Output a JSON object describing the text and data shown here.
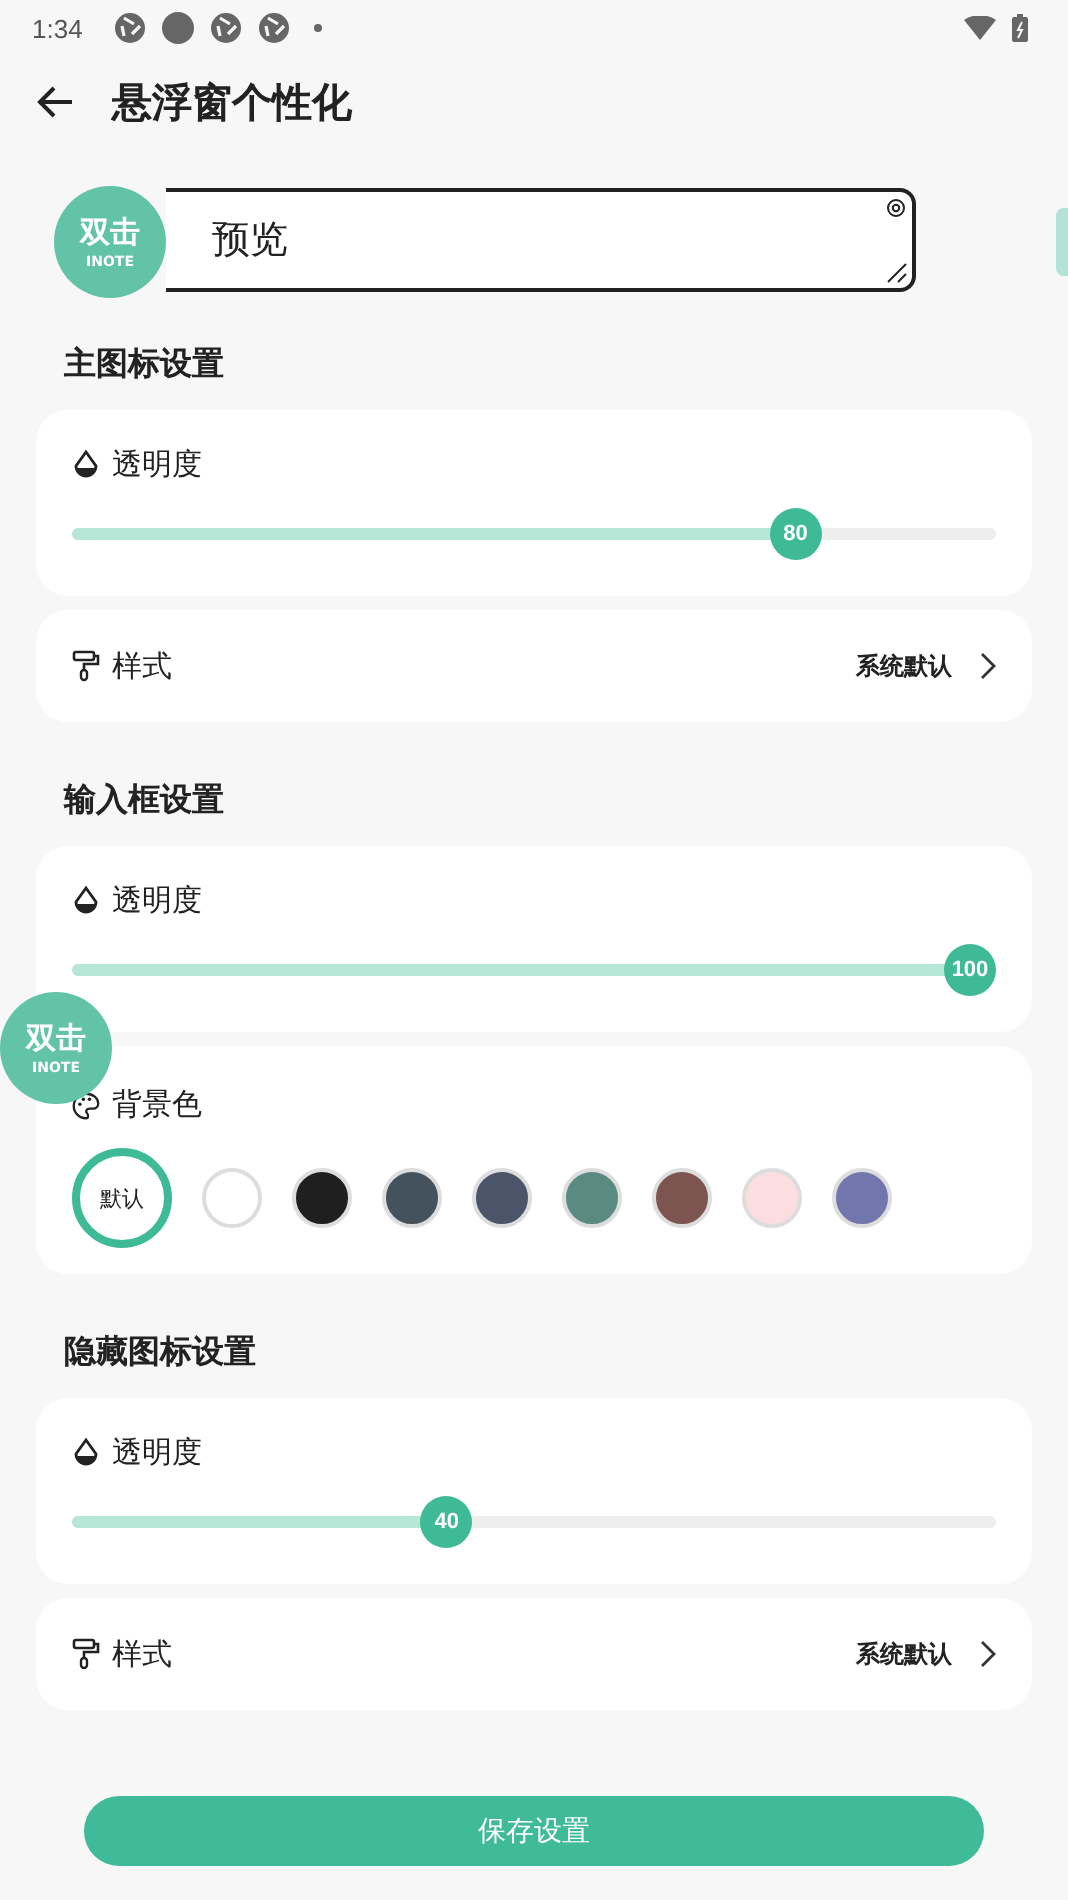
{
  "status_bar": {
    "time": "1:34"
  },
  "header": {
    "title": "悬浮窗个性化"
  },
  "preview": {
    "bubble_text": "双击",
    "bubble_subtext": "INOTE",
    "text": "预览"
  },
  "sections": [
    {
      "title": "主图标设置",
      "cards": [
        {
          "kind": "slider",
          "label": "透明度",
          "level": 0.8,
          "reading": "80"
        },
        {
          "kind": "link",
          "label": "样式",
          "value": "系统默认"
        }
      ]
    },
    {
      "title": "输入框设置",
      "cards": [
        {
          "kind": "slider",
          "label": "透明度",
          "level": 1,
          "reading": "100"
        },
        {
          "kind": "colors",
          "label": "背景色",
          "swatches": [
            {
              "label": "默认",
              "selected": true
            },
            {
              "color": "#ffffff",
              "selected": false
            },
            {
              "color": "#1f1f1f",
              "selected": false
            },
            {
              "color": "#43525c",
              "selected": false
            },
            {
              "color": "#4b5468",
              "selected": false
            },
            {
              "color": "#5a8a80",
              "selected": false
            },
            {
              "color": "#7c5550",
              "selected": false
            },
            {
              "color": "#fcdde0",
              "selected": false
            },
            {
              "color": "#7276ad",
              "selected": false
            }
          ]
        }
      ]
    },
    {
      "title": "隐藏图标设置",
      "cards": [
        {
          "kind": "slider",
          "label": "透明度",
          "level": 0.4,
          "reading": "40"
        },
        {
          "kind": "link",
          "label": "样式",
          "value": "系统默认"
        }
      ]
    }
  ],
  "floating_bubble": {
    "text": "双击",
    "subtext": "INOTE"
  },
  "save_button": "保存设置"
}
